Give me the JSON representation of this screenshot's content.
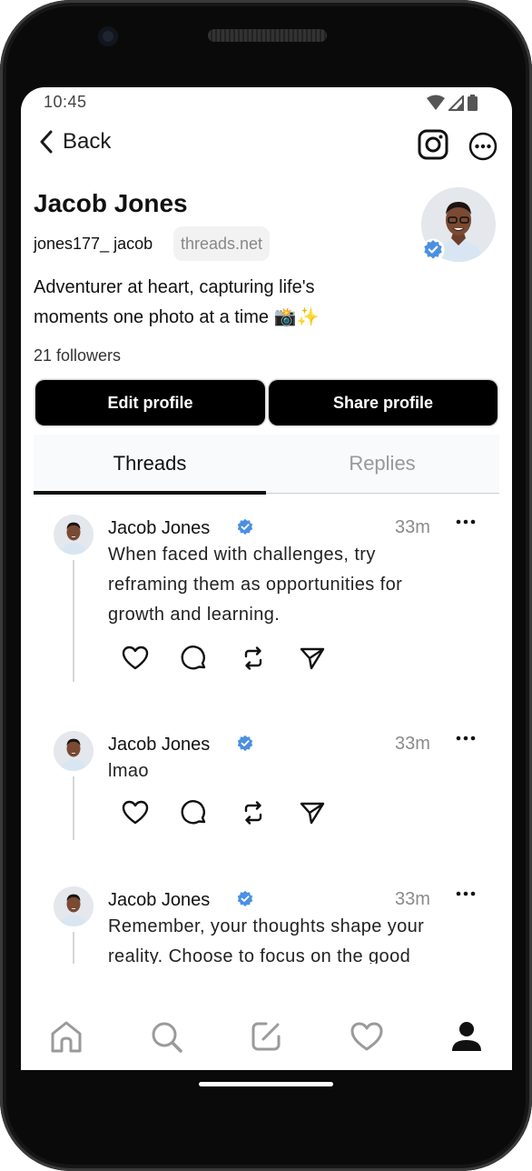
{
  "status_bar": {
    "time": "10:45"
  },
  "nav": {
    "back_label": "Back"
  },
  "profile": {
    "name": "Jacob Jones",
    "handle": "jones177_ jacob",
    "domain": "threads.net",
    "bio_line1": "Adventurer at heart, capturing life's",
    "bio_line2": "moments one photo at a time 📸✨",
    "followers": "21 followers",
    "verified_color": "#4a90e2"
  },
  "buttons": {
    "edit": "Edit profile",
    "share": "Share profile"
  },
  "tabs": [
    {
      "label": "Threads",
      "active": true
    },
    {
      "label": "Replies",
      "active": false
    }
  ],
  "posts": [
    {
      "author": "Jacob Jones",
      "time": "33m",
      "lines": [
        "When faced with challenges, try",
        "reframing them as opportunities for",
        "growth and learning."
      ]
    },
    {
      "author": "Jacob Jones",
      "time": "33m",
      "lines": [
        "lmao"
      ]
    },
    {
      "author": "Jacob Jones",
      "time": "33m",
      "lines": [
        "Remember, your thoughts shape your",
        "reality. Choose to focus on the good"
      ]
    }
  ],
  "post_actions": [
    "heart-icon",
    "comment-icon",
    "repost-icon",
    "send-icon"
  ],
  "bottom_nav": [
    "home-icon",
    "search-icon",
    "compose-icon",
    "activity-heart-icon",
    "profile-icon"
  ]
}
